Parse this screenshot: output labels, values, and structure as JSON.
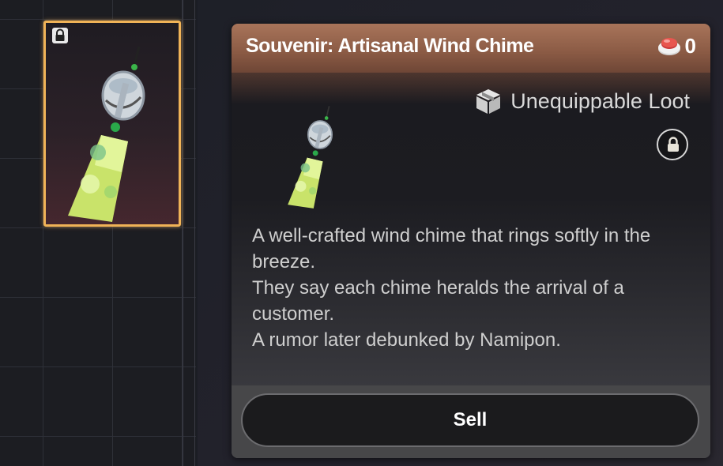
{
  "item": {
    "title": "Souvenir: Artisanal Wind Chime",
    "currency_value": "0",
    "type_label": "Unequippable Loot",
    "description": [
      "A well-crafted wind chime that rings softly in the breeze.",
      "They say each chime heralds the arrival of a customer.",
      "A rumor later debunked by Namipon."
    ],
    "sell_label": "Sell"
  },
  "icons": {
    "slot_lock": "lock-icon",
    "panel_lock": "lock-icon",
    "currency": "red-button-token-icon",
    "type": "box-icon",
    "item_art": "wind-chime-icon"
  },
  "colors": {
    "slot_highlight": "#f0b357",
    "header_bg": "#8a5a44",
    "footer_bg": "#474749",
    "button_bg": "#1b1b1d"
  }
}
